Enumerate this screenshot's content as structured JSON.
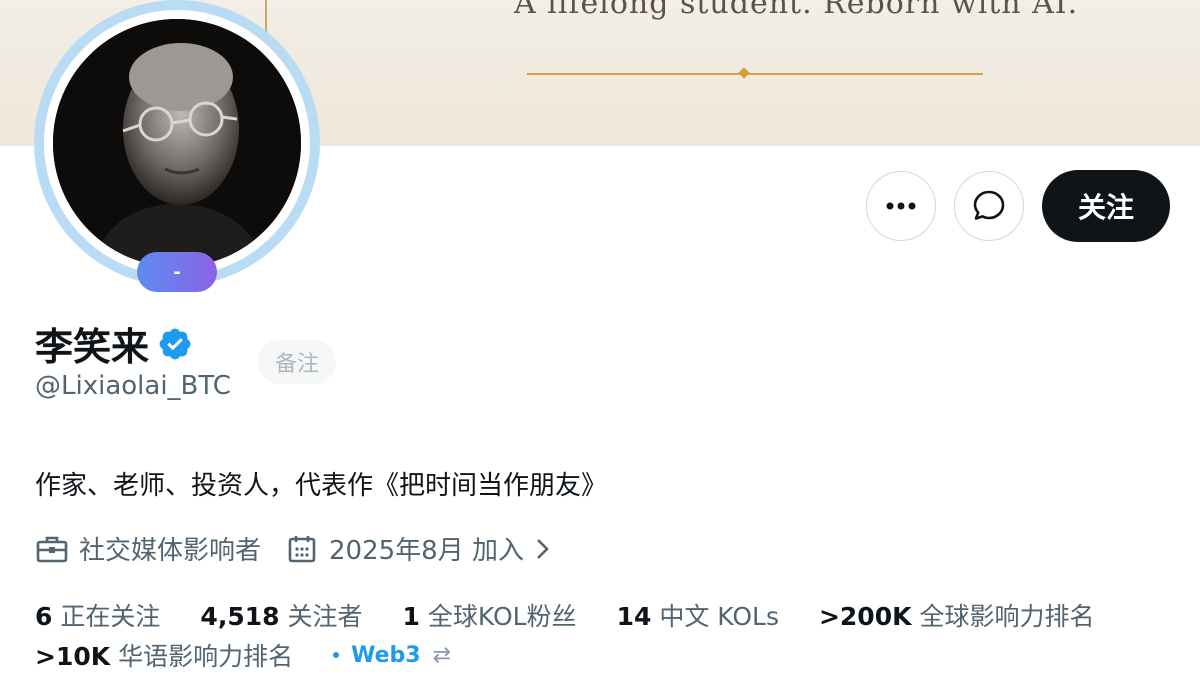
{
  "banner": {
    "tagline": "A lifelong student. Reborn with AI."
  },
  "avatar": {
    "badge": "-"
  },
  "actions": {
    "more_icon": "more-horizontal-icon",
    "message_icon": "message-bubble-icon",
    "follow_label": "关注"
  },
  "profile": {
    "name": "李笑来",
    "verified": true,
    "note_label": "备注",
    "handle": "@Lixiaolai_BTC",
    "bio": "作家、老师、投资人，代表作《把时间当作朋友》",
    "category": "社交媒体影响者",
    "joined": "2025年8月 加入"
  },
  "stats": {
    "following_count": "6",
    "following_label": "正在关注",
    "followers_count": "4,518",
    "followers_label": "关注者",
    "kol_count": "1",
    "kol_label": "全球KOL粉丝",
    "cn_kol_count": "14",
    "cn_kol_label": "中文 KOLs",
    "global_rank": ">200K",
    "global_rank_label": "全球影响力排名",
    "cn_rank": ">10K",
    "cn_rank_label": "华语影响力排名",
    "tag": "Web3"
  },
  "colors": {
    "accent": "#1d9bf0",
    "follow_bg": "#0f1419",
    "muted": "#536471"
  }
}
